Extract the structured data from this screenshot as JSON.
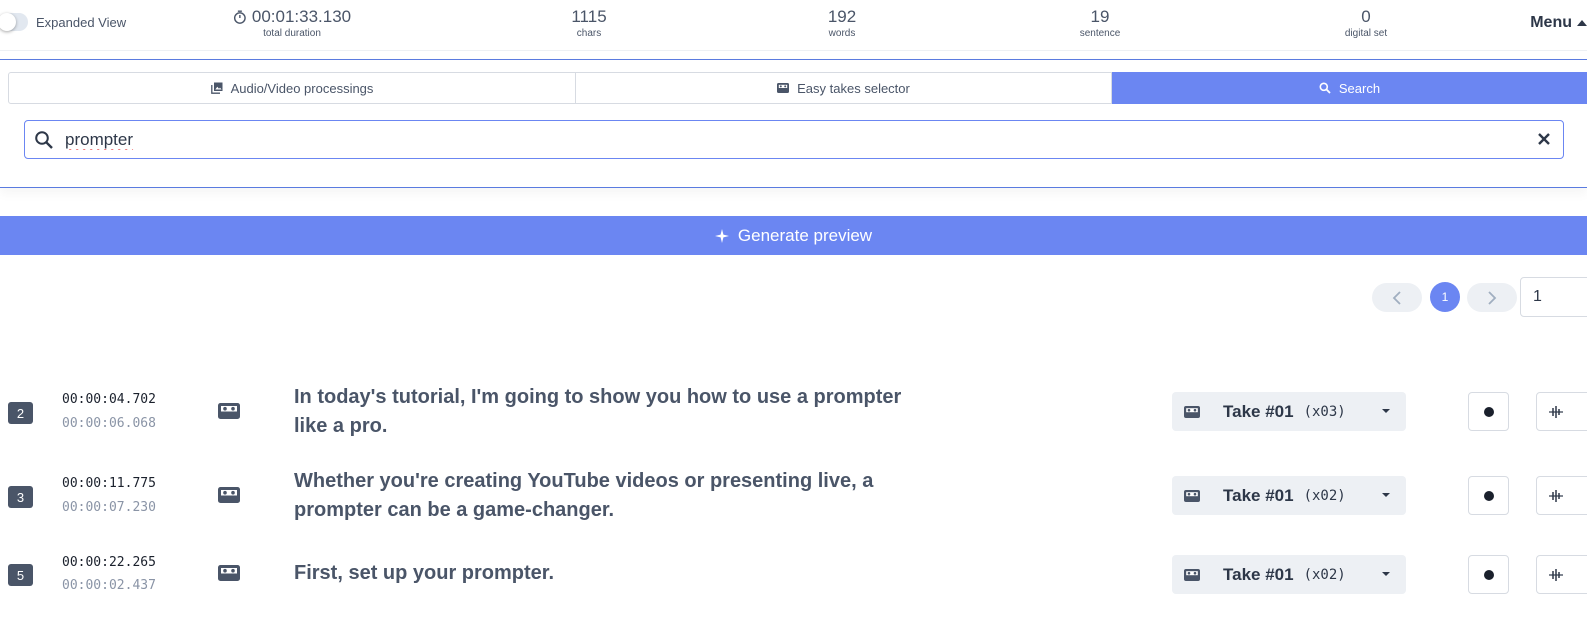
{
  "header": {
    "expanded_view_label": "Expanded View",
    "stats": [
      {
        "value": "00:01:33.130",
        "label": "total duration"
      },
      {
        "value": "1115",
        "label": "chars"
      },
      {
        "value": "192",
        "label": "words"
      },
      {
        "value": "19",
        "label": "sentence"
      },
      {
        "value": "0",
        "label": "digital set"
      }
    ],
    "menu_label": "Menu"
  },
  "tabs": [
    {
      "label": "Audio/Video processings",
      "icon": "photo-library-icon"
    },
    {
      "label": "Easy takes selector",
      "icon": "tape-icon"
    },
    {
      "label": "Search",
      "icon": "search-icon",
      "active": true
    }
  ],
  "search": {
    "value": "prompter",
    "placeholder": ""
  },
  "generate_preview_label": "Generate preview",
  "pagination": {
    "current_page": "1",
    "page_input": "1"
  },
  "rows": [
    {
      "num": "2",
      "start": "00:00:04.702",
      "duration": "00:00:06.068",
      "text": "In today's tutorial, I'm going to show you how to use a prompter like a pro.",
      "take": "Take #01",
      "take_count": "(x03)"
    },
    {
      "num": "3",
      "start": "00:00:11.775",
      "duration": "00:00:07.230",
      "text": "Whether you're creating YouTube videos or presenting live, a prompter can be a game-changer.",
      "take": "Take #01",
      "take_count": "(x02)"
    },
    {
      "num": "5",
      "start": "00:00:22.265",
      "duration": "00:00:02.437",
      "text": "First, set up your prompter.",
      "take": "Take #01",
      "take_count": "(x02)"
    }
  ],
  "colors": {
    "accent": "#6b86f2",
    "text": "#4a5568",
    "badge": "#4a5568"
  }
}
